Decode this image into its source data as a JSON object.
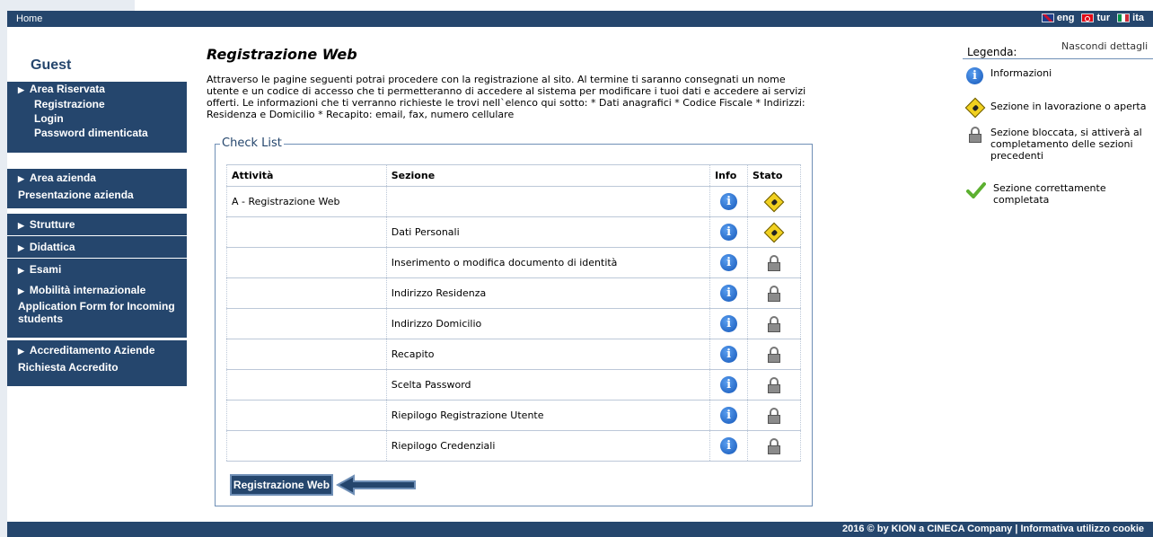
{
  "topbar": {
    "home": "Home",
    "languages": [
      {
        "code": "eng",
        "flag": "uk-flag-icon"
      },
      {
        "code": "tur",
        "flag": "tr-flag-icon"
      },
      {
        "code": "ita",
        "flag": "it-flag-icon"
      }
    ]
  },
  "sidebar": {
    "user": "Guest",
    "area_riservata": {
      "title": "Area Riservata",
      "items": [
        "Registrazione",
        "Login",
        "Password dimenticata"
      ]
    },
    "area_azienda": {
      "title": "Area azienda",
      "items": [
        "Presentazione azienda"
      ]
    },
    "strutture": "Strutture",
    "didattica": "Didattica",
    "esami": "Esami",
    "mobilita": {
      "title": "Mobilità internazionale",
      "items": [
        "Application Form for Incoming students"
      ]
    },
    "accreditamento": {
      "title": "Accreditamento Aziende",
      "items": [
        "Richiesta Accredito"
      ]
    }
  },
  "main": {
    "title": "Registrazione Web",
    "intro": "Attraverso le pagine seguenti potrai procedere con la registrazione al sito. Al termine ti saranno consegnati un nome utente e un codice di accesso che ti permetteranno di accedere al sistema per modificare i tuoi dati e accedere ai servizi offerti. Le informazioni che ti verranno richieste le trovi nell`elenco qui sotto: * Dati anagrafici * Codice Fiscale * Indirizzi: Residenza e Domicilio * Recapito: email, fax, numero cellulare",
    "checklist": {
      "legend": "Check List",
      "headers": [
        "Attività",
        "Sezione",
        "Info",
        "Stato"
      ],
      "rows": [
        {
          "attivita": "A - Registrazione Web",
          "sezione": "",
          "stato": "in-progress"
        },
        {
          "attivita": "",
          "sezione": "Dati Personali",
          "stato": "in-progress"
        },
        {
          "attivita": "",
          "sezione": "Inserimento o modifica documento di identità",
          "stato": "locked"
        },
        {
          "attivita": "",
          "sezione": "Indirizzo Residenza",
          "stato": "locked"
        },
        {
          "attivita": "",
          "sezione": "Indirizzo Domicilio",
          "stato": "locked"
        },
        {
          "attivita": "",
          "sezione": "Recapito",
          "stato": "locked"
        },
        {
          "attivita": "",
          "sezione": "Scelta Password",
          "stato": "locked"
        },
        {
          "attivita": "",
          "sezione": "Riepilogo Registrazione Utente",
          "stato": "locked"
        },
        {
          "attivita": "",
          "sezione": "Riepilogo Credenziali",
          "stato": "locked"
        }
      ]
    },
    "button": "Registrazione Web"
  },
  "legend": {
    "title": "Legenda:",
    "hide": "Nascondi dettagli",
    "items": [
      {
        "icon": "info-icon",
        "text": "Informazioni"
      },
      {
        "icon": "work-in-progress-icon",
        "text": "Sezione in lavorazione o aperta"
      },
      {
        "icon": "lock-icon",
        "text": "Sezione bloccata, si attiverà al completamento delle sezioni precedenti"
      },
      {
        "icon": "checkmark-icon",
        "text": "Sezione correttamente completata"
      }
    ]
  },
  "footer": {
    "text": "2016 © by KION a CINECA Company | Informativa utilizzo cookie"
  },
  "colors": {
    "nav": "#25466d",
    "border": "#6f8fb6",
    "info": "#1456b8",
    "work": "#f1d01f",
    "check": "#5cb030"
  }
}
